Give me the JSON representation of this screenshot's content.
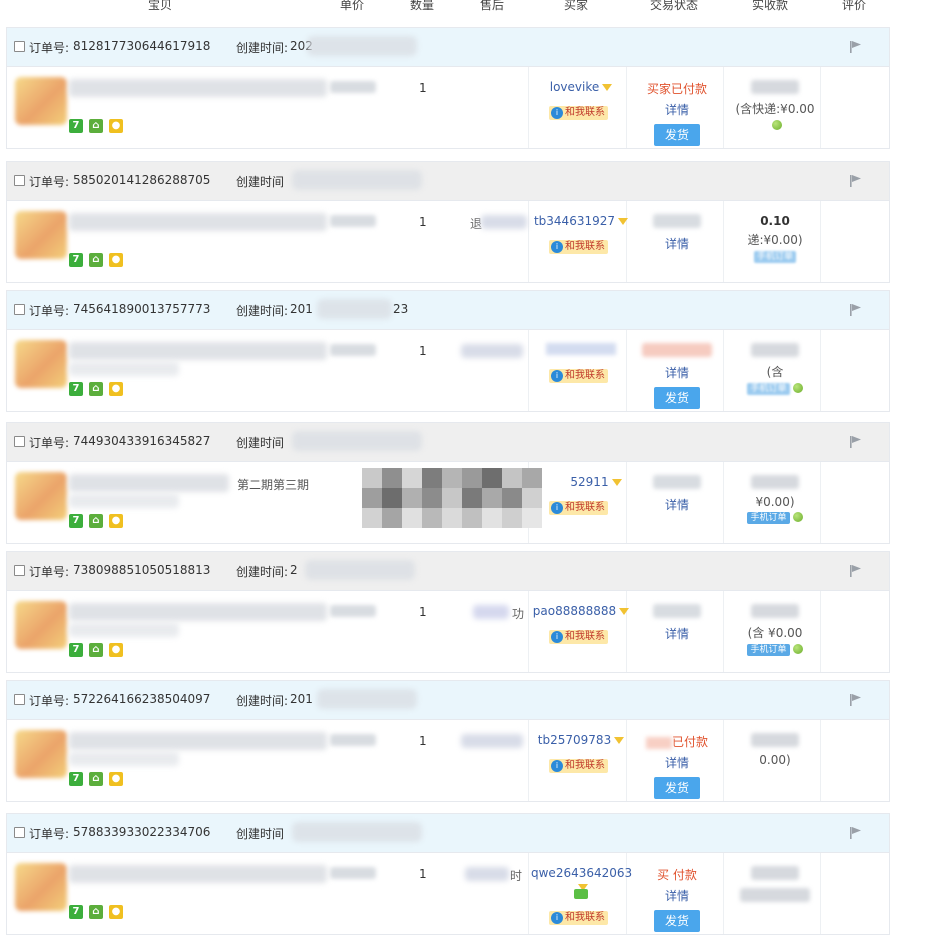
{
  "header": {
    "columns": [
      "宝贝",
      "单价",
      "数量",
      "售后",
      "买家",
      "交易状态",
      "实收款",
      "评价"
    ]
  },
  "labels": {
    "order_no": "订单号:",
    "created": "创建时间:",
    "created_short": "创建时间",
    "contact": "和我联系",
    "detail": "详情",
    "ship": "发货",
    "mobile_order": "手机订单",
    "badge_7": "7"
  },
  "orders": [
    {
      "order_no": "812817730644617918",
      "created_visible": "202",
      "qty": "1",
      "after_sale": "",
      "buyer": "lovevike",
      "status_text": "买家已付款",
      "detail": "详情",
      "ship_button": "发货",
      "received": "",
      "shipping_fee": "(含快递:¥0.00",
      "mobile": false,
      "theme": "blue"
    },
    {
      "order_no": "585020141286288705",
      "created_visible": "",
      "qty": "1",
      "after_sale": "退",
      "buyer": "tb344631927",
      "status_text": "",
      "detail": "详情",
      "ship_button": "",
      "received": "0.10",
      "shipping_fee": "递:¥0.00)",
      "mobile": false,
      "theme": "grey"
    },
    {
      "order_no": "745641890013757773",
      "created_visible": "201",
      "created_tail": "23",
      "qty": "1",
      "after_sale": "",
      "buyer": "",
      "status_text": "",
      "detail": "详情",
      "ship_button": "发货",
      "received": "",
      "shipping_fee": "(含",
      "mobile": false,
      "theme": "blue"
    },
    {
      "order_no": "744930433916345827",
      "created_visible": "",
      "qty": "",
      "after_sale": "",
      "buyer": "52911",
      "status_text": "",
      "detail": "详情",
      "ship_button": "",
      "received": "",
      "shipping_fee": "¥0.00)",
      "mobile": true,
      "title_fragment": "第二期第三期",
      "theme": "grey"
    },
    {
      "order_no": "738098851050518813",
      "created_visible": "2",
      "qty": "1",
      "after_sale": "功",
      "buyer": "pao88888888",
      "status_text": "",
      "detail": "详情",
      "ship_button": "",
      "received": "",
      "shipping_fee": "(含  ¥0.00",
      "mobile": true,
      "theme": "grey"
    },
    {
      "order_no": "572264166238504097",
      "created_visible": "201",
      "qty": "1",
      "after_sale": "",
      "buyer": "tb25709783",
      "status_text": "已付款",
      "detail": "详情",
      "ship_button": "发货",
      "received": "",
      "shipping_fee": "0.00)",
      "mobile": false,
      "theme": "blue"
    },
    {
      "order_no": "578833933022334706",
      "created_visible": "",
      "qty": "1",
      "after_sale": "时",
      "buyer": "qwe2643642063",
      "status_text": "买  付款",
      "detail": "详情",
      "ship_button": "发货",
      "received": "",
      "shipping_fee": "",
      "mobile": false,
      "theme": "blue"
    }
  ]
}
